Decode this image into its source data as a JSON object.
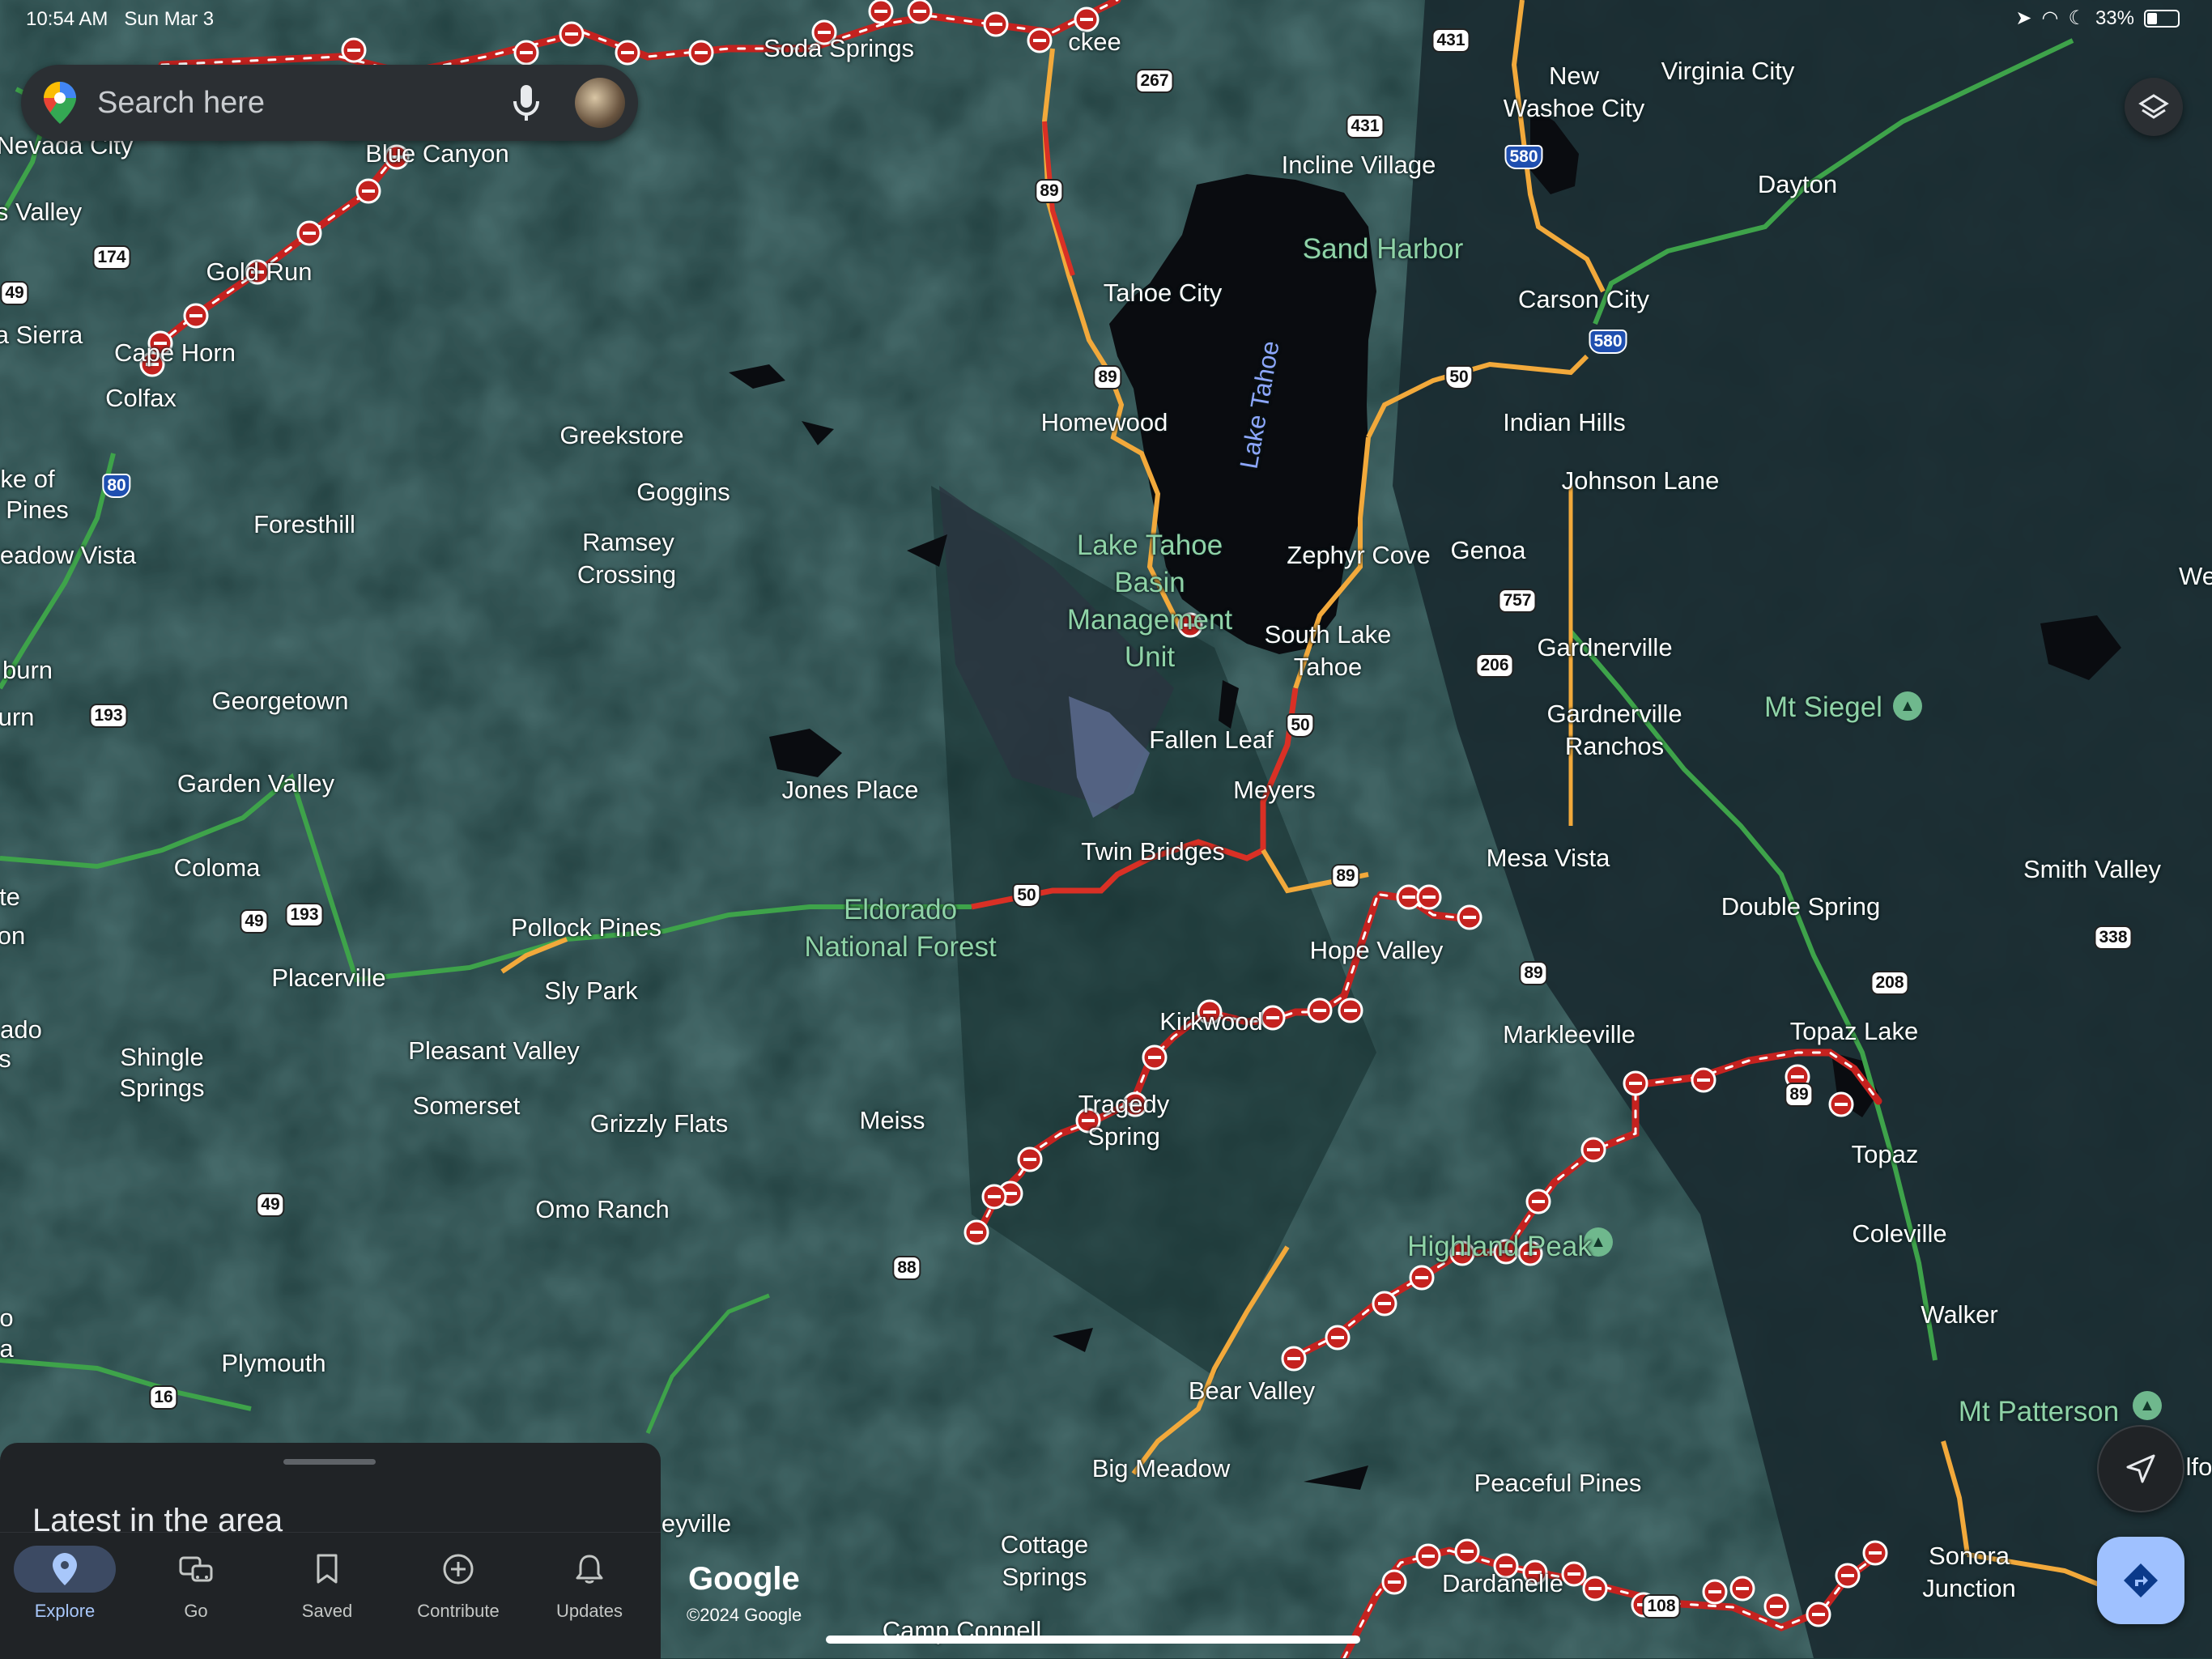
{
  "status_bar": {
    "time": "10:54 AM",
    "date": "Sun Mar 3",
    "battery": "33%",
    "battery_level": 0.33
  },
  "search": {
    "placeholder": "Search here"
  },
  "towns": [
    "Soda Springs",
    "ckee",
    "Blue Canyon",
    "Nevada City",
    "s Valley",
    "Gold Run",
    "a Sierra",
    "Cape Horn",
    "Colfax",
    "ke of",
    "Pines",
    "eadow Vista",
    "Foresthill",
    "Greekstore",
    "Goggins",
    "Ramsey",
    "Crossing",
    "burn",
    "urn",
    "Georgetown",
    "Garden Valley",
    "Coloma",
    "Jones Place",
    "te",
    "on",
    "Pollock Pines",
    "Placerville",
    "Sly Park",
    "ado",
    "s",
    "Shingle",
    "Springs",
    "Pleasant Valley",
    "Somerset",
    "Grizzly Flats",
    "Meiss",
    "Omo Ranch",
    "o",
    "a",
    "Plymouth",
    "eyville",
    "Incline Village",
    "New",
    "Washoe City",
    "Virginia City",
    "Dayton",
    "Tahoe City",
    "Carson City",
    "Homewood",
    "Indian Hills",
    "Johnson Lane",
    "Zephyr Cove",
    "Genoa",
    "We",
    "South Lake",
    "Tahoe",
    "Gardnerville",
    "Gardnerville",
    "Ranchos",
    "Fallen Leaf",
    "Meyers",
    "Twin Bridges",
    "Mesa Vista",
    "Smith Valley",
    "Double Spring",
    "Hope Valley",
    "Kirkwood",
    "Markleeville",
    "Topaz Lake",
    "Tragedy",
    "Spring",
    "Topaz",
    "Coleville",
    "Walker",
    "Bear Valley",
    "Big Meadow",
    "Peaceful Pines",
    "Cottage",
    "Springs",
    "Camp Connell",
    "Dardanelle",
    "Sonora",
    "Junction",
    "lfo"
  ],
  "parks": [
    "Sand Harbor",
    "Lake Tahoe",
    "Basin",
    "Management",
    "Unit",
    "Eldorado",
    "National Forest",
    "Mt Siegel",
    "Highland Peak",
    "Mt Patterson"
  ],
  "water": [
    "Lake Tahoe"
  ],
  "highways": [
    "431",
    "431",
    "267",
    "89",
    "89",
    "580",
    "580",
    "50",
    "174",
    "49",
    "80",
    "757",
    "206",
    "50",
    "193",
    "89",
    "50",
    "49",
    "193",
    "89",
    "338",
    "208",
    "89",
    "88",
    "49",
    "16",
    "108"
  ],
  "bottom_sheet": {
    "heading": "Latest in the area"
  },
  "nav": {
    "explore": "Explore",
    "go": "Go",
    "saved": "Saved",
    "contribute": "Contribute",
    "updates": "Updates"
  },
  "branding": {
    "logo": "Google",
    "copyright": "©2024 Google"
  },
  "colors": {
    "background": "#1f3a3a",
    "closure": "#c5221f",
    "traffic_green": "#3ea34a",
    "traffic_orange": "#f2a93b",
    "accent": "#a8c7fa"
  }
}
